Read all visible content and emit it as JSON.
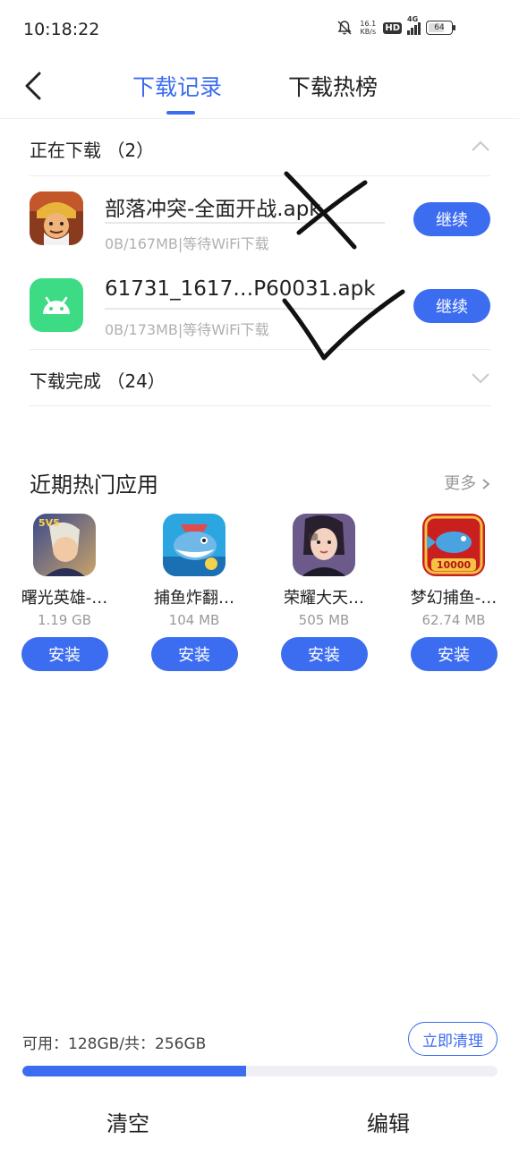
{
  "status_bar": {
    "time": "10:18:22",
    "speed_value": "16.1",
    "speed_unit": "KB/s",
    "hd": "HD",
    "network": "4G",
    "battery": "64"
  },
  "header": {
    "tabs": [
      {
        "label": "下载记录",
        "active": true
      },
      {
        "label": "下载热榜",
        "active": false
      }
    ]
  },
  "downloading": {
    "title": "正在下载 （2）",
    "items": [
      {
        "name": "部落冲突-全面开战.apk",
        "status": "0B/167MB|等待WiFi下载",
        "action": "继续",
        "icon": "clash-of-clans-icon"
      },
      {
        "name": "61731_1617…P60031.apk",
        "status": "0B/173MB|等待WiFi下载",
        "action": "继续",
        "icon": "android-icon"
      }
    ]
  },
  "completed": {
    "title": "下载完成 （24）"
  },
  "hot_apps": {
    "title": "近期热门应用",
    "more": "更多",
    "items": [
      {
        "name": "曙光英雄-…",
        "size": "1.19 GB",
        "action": "安装",
        "badge": "5V5"
      },
      {
        "name": "捕鱼炸翻…",
        "size": "104 MB",
        "action": "安装"
      },
      {
        "name": "荣耀大天…",
        "size": "505 MB",
        "action": "安装"
      },
      {
        "name": "梦幻捕鱼-…",
        "size": "62.74 MB",
        "action": "安装",
        "badge": "10000"
      }
    ]
  },
  "storage": {
    "text": "可用：128GB/共：256GB",
    "clean_label": "立即清理",
    "used_fraction": 0.47
  },
  "bottom_bar": {
    "clear_label": "清空",
    "edit_label": "编辑"
  },
  "colors": {
    "accent": "#3c6cf0"
  }
}
